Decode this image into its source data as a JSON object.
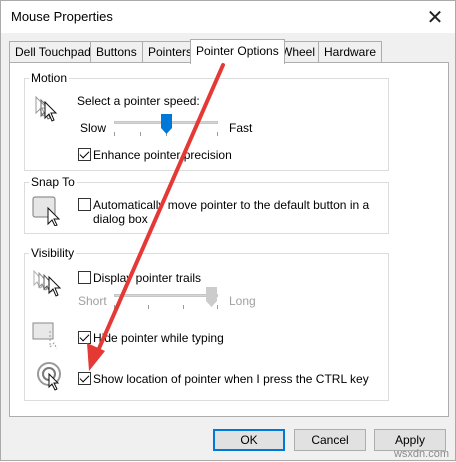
{
  "window": {
    "title": "Mouse Properties",
    "close_glyph": "✕"
  },
  "tabs": [
    {
      "label": "Dell Touchpad"
    },
    {
      "label": "Buttons"
    },
    {
      "label": "Pointers"
    },
    {
      "label": "Pointer Options",
      "active": true
    },
    {
      "label": "Wheel"
    },
    {
      "label": "Hardware"
    }
  ],
  "motion": {
    "legend": "Motion",
    "speed_label": "Select a pointer speed:",
    "slow": "Slow",
    "fast": "Fast",
    "speed_level": 0.5,
    "enhance_label": "Enhance pointer precision",
    "enhance_checked": true
  },
  "snap_to": {
    "legend": "Snap To",
    "label": "Automatically move pointer to the default button in a dialog box",
    "line1": "Automatically move pointer to the default button in a",
    "line2": "dialog box",
    "checked": false
  },
  "visibility": {
    "legend": "Visibility",
    "trails_label": "Display pointer trails",
    "trails_checked": false,
    "short": "Short",
    "long": "Long",
    "trail_length_level": 1.0,
    "hide_label": "Hide pointer while typing",
    "hide_checked": true,
    "ctrl_label": "Show location of pointer when I press the CTRL key",
    "ctrl_checked": true
  },
  "buttons": {
    "ok": "OK",
    "cancel": "Cancel",
    "apply": "Apply"
  },
  "watermark": "wsxdn.com",
  "colors": {
    "accent": "#0078d7",
    "annotation_arrow": "#e53935"
  }
}
